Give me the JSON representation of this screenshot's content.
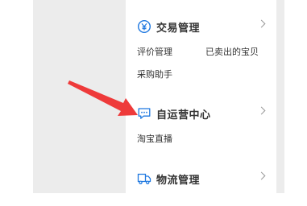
{
  "sections": [
    {
      "title": "交易管理",
      "icon": "yen-circle-icon",
      "items": [
        "评价管理",
        "已卖出的宝贝",
        "采购助手"
      ]
    },
    {
      "title": "自运营中心",
      "icon": "chat-bubble-icon",
      "items": [
        "淘宝直播"
      ]
    },
    {
      "title": "物流管理",
      "icon": "truck-icon",
      "items": []
    }
  ],
  "colors": {
    "accent": "#1e78e0",
    "arrow": "#ee3a3a",
    "sidebar_bg": "#ececec",
    "text": "#333333"
  }
}
